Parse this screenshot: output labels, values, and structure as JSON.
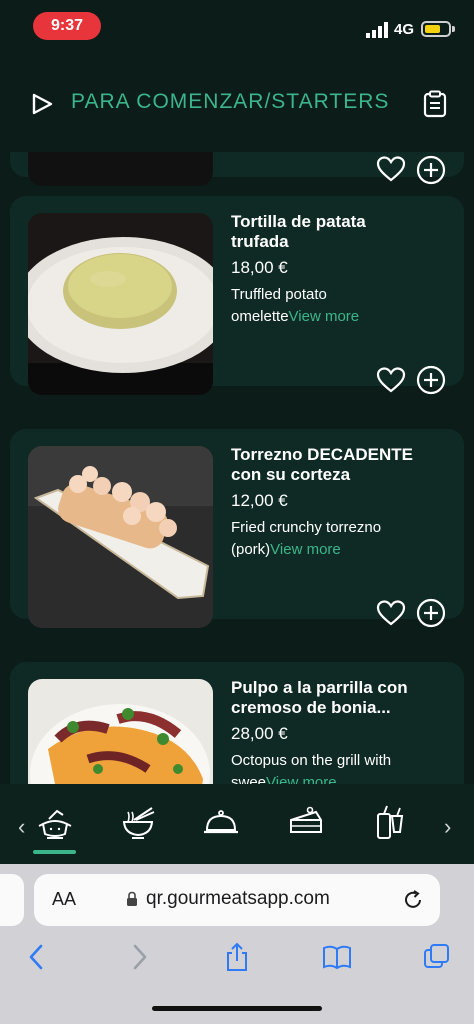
{
  "status_bar": {
    "time": "9:37",
    "network": "4G"
  },
  "header": {
    "title": "PARA COMENZAR/STARTERS"
  },
  "items": [
    {
      "name_line1": "Tortilla de patata",
      "name_line2": "trufada",
      "price": "18,00 €",
      "desc_line1": "Truffled potato",
      "desc_line2": "omelette",
      "view_more": "View more"
    },
    {
      "name_line1": "Torrezno DECADENTE",
      "name_line2": "con su corteza",
      "price": "12,00 €",
      "desc_line1": "Fried crunchy torrezno",
      "desc_line2": "(pork)",
      "view_more": "View more"
    },
    {
      "name_line1": "Pulpo a la parrilla con",
      "name_line2": "cremoso de bonia...",
      "price": "28,00 €",
      "desc_line1": "Octopus on the grill with",
      "desc_line2": "swee",
      "view_more": "View more"
    }
  ],
  "categories": [
    {
      "icon": "pot-icon",
      "active": true
    },
    {
      "icon": "noodle-bowl-icon",
      "active": false
    },
    {
      "icon": "cloche-icon",
      "active": false
    },
    {
      "icon": "cake-slice-icon",
      "active": false
    },
    {
      "icon": "drinks-icon",
      "active": false
    }
  ],
  "browser": {
    "aa_label": "AA",
    "url": "qr.gourmeatsapp.com"
  },
  "colors": {
    "accent": "#3bb58a",
    "background": "#0b1c19",
    "card": "#0f2a25",
    "time_pill": "#e8343b",
    "battery": "#f5d20e"
  }
}
